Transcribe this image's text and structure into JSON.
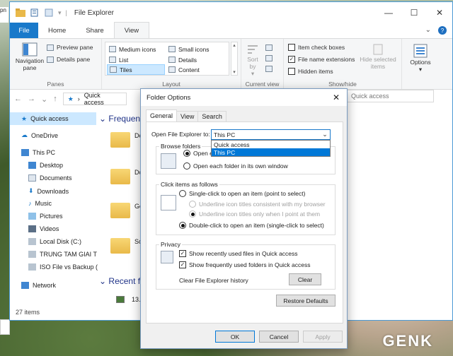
{
  "explorer": {
    "title": "File Explorer",
    "tabs": [
      "File",
      "Home",
      "Share",
      "View"
    ],
    "ribbon": {
      "panes": {
        "navigation_pane": "Navigation pane",
        "preview_pane": "Preview pane",
        "details_pane": "Details pane",
        "label": "Panes"
      },
      "layout": {
        "items": [
          "Medium icons",
          "Small icons",
          "List",
          "Details",
          "Tiles",
          "Content"
        ],
        "selected": "Tiles",
        "label": "Layout"
      },
      "current_view": {
        "sort_by": "Sort by",
        "label": "Current view"
      },
      "show_hide": {
        "item_check_boxes": "Item check boxes",
        "file_name_extensions": "File name extensions",
        "hidden_items": "Hidden items",
        "hide_selected": "Hide selected items",
        "label": "Show/hide",
        "item_check_boxes_checked": false,
        "file_name_extensions_checked": true,
        "hidden_items_checked": false
      },
      "options": "Options"
    },
    "address": {
      "location": "Quick access",
      "search_placeholder": "Quick access"
    },
    "nav": {
      "items": [
        "Quick access",
        "OneDrive",
        "This PC",
        "Desktop",
        "Documents",
        "Downloads",
        "Music",
        "Pictures",
        "Videos",
        "Local Disk (C:)",
        "TRUNG TAM GIAI T",
        "ISO File vs Backup (",
        "Network"
      ]
    },
    "content": {
      "frequent_header": "Frequent",
      "recent_header": "Recent fil",
      "frequent_items": [
        "De",
        "Do",
        "Ge",
        "Sc"
      ],
      "recent_items": [
        "13.png"
      ]
    },
    "status": "27 items"
  },
  "dialog": {
    "title": "Folder Options",
    "tabs": [
      "General",
      "View",
      "Search"
    ],
    "open_label": "Open File Explorer to:",
    "open_value": "This PC",
    "dropdown_options": [
      "Quick access",
      "This PC"
    ],
    "browse": {
      "legend": "Browse folders",
      "opt1": "Open each folder in the same window",
      "opt2": "Open each folder in its own window"
    },
    "click": {
      "legend": "Click items as follows",
      "single": "Single-click to open an item (point to select)",
      "underline_browser": "Underline icon titles consistent with my browser",
      "underline_point": "Underline icon titles only when I point at them",
      "double": "Double-click to open an item (single-click to select)"
    },
    "privacy": {
      "legend": "Privacy",
      "recent_files": "Show recently used files in Quick access",
      "frequent_folders": "Show frequently used folders in Quick access",
      "clear_history": "Clear File Explorer history",
      "clear_button": "Clear"
    },
    "restore_defaults": "Restore Defaults",
    "ok": "OK",
    "cancel": "Cancel",
    "apply": "Apply"
  },
  "desktop": {
    "corner_label": "pn",
    "watermark": "GENK"
  },
  "colors": {
    "accent": "#1979ca",
    "selection": "#cce8ff",
    "highlight": "#0078d7"
  }
}
